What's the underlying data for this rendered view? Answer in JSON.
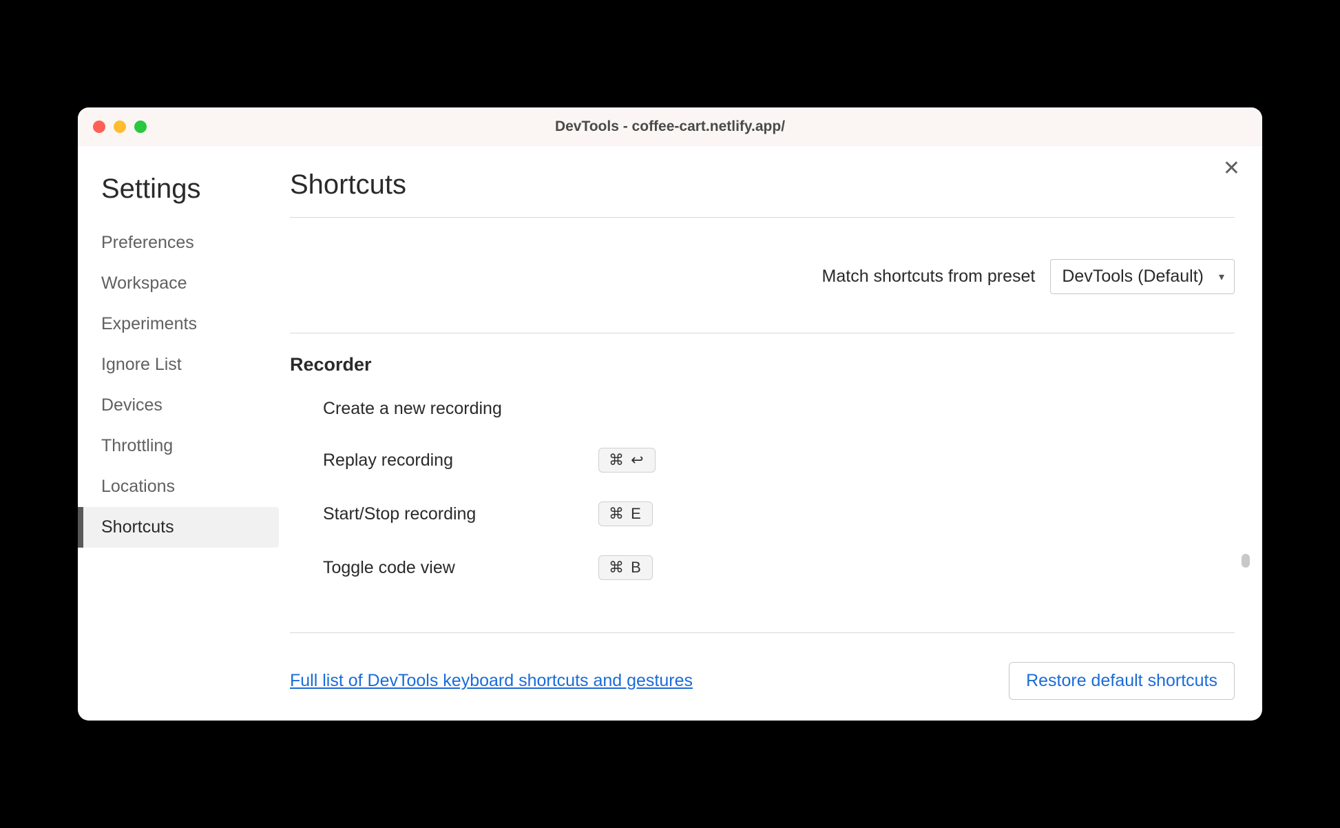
{
  "window": {
    "title": "DevTools - coffee-cart.netlify.app/"
  },
  "sidebar": {
    "title": "Settings",
    "items": [
      {
        "label": "Preferences"
      },
      {
        "label": "Workspace"
      },
      {
        "label": "Experiments"
      },
      {
        "label": "Ignore List"
      },
      {
        "label": "Devices"
      },
      {
        "label": "Throttling"
      },
      {
        "label": "Locations"
      },
      {
        "label": "Shortcuts"
      }
    ]
  },
  "page": {
    "title": "Shortcuts",
    "preset_label": "Match shortcuts from preset",
    "preset_value": "DevTools (Default)"
  },
  "section": {
    "heading": "Recorder",
    "shortcuts": [
      {
        "label": "Create a new recording",
        "keys": ""
      },
      {
        "label": "Replay recording",
        "keys": "⌘  ↩"
      },
      {
        "label": "Start/Stop recording",
        "keys": "⌘  E"
      },
      {
        "label": "Toggle code view",
        "keys": "⌘  B"
      }
    ]
  },
  "footer": {
    "link_label": "Full list of DevTools keyboard shortcuts and gestures",
    "restore_label": "Restore default shortcuts"
  }
}
